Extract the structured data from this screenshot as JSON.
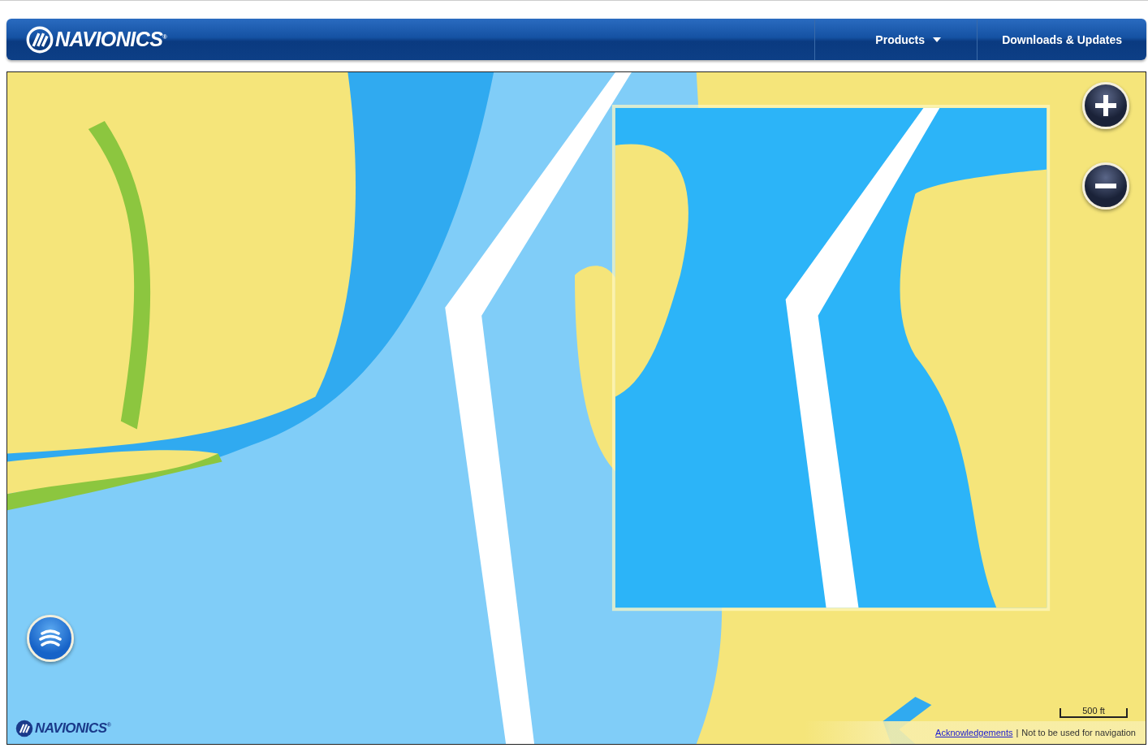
{
  "header": {
    "logo": "NAVIONICS$^{®}$",
    "nav": [
      {
        "label": "Products",
        "has_dropdown": true
      },
      {
        "label": "Downloads & Updates",
        "has_dropdown": false
      }
    ]
  },
  "map": {
    "kind": "picture",
    "logo": "NAVIONICS$^{®}$",
    "scale": "500 ft",
    "link": "Acknowledgements",
    "separator": "|",
    "notice": "Not to be used for navigation"
  }
}
